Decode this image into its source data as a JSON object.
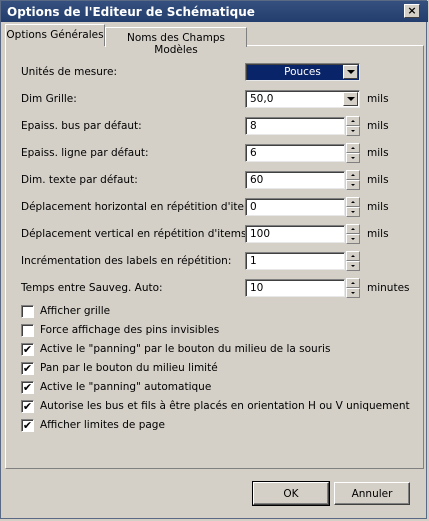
{
  "window": {
    "title": "Options de l'Editeur de Schématique",
    "close_glyph": "×"
  },
  "tabs": [
    {
      "label": "Options Générales",
      "active": true
    },
    {
      "label": "Noms des Champs Modèles",
      "active": false
    }
  ],
  "settings": {
    "units": {
      "label": "Unités de mesure:",
      "value": "Pouces"
    },
    "grid": {
      "label": "Dim Grille:",
      "value": "50,0",
      "unit": "mils"
    },
    "bus_width": {
      "label": "Epaiss. bus par défaut:",
      "value": "8",
      "unit": "mils"
    },
    "line_width": {
      "label": "Epaiss. ligne par défaut:",
      "value": "6",
      "unit": "mils"
    },
    "text_size": {
      "label": "Dim. texte par défaut:",
      "value": "60",
      "unit": "mils"
    },
    "repeat_h": {
      "label": "Déplacement horizontal en répétition d'items:",
      "value": "0",
      "unit": "mils"
    },
    "repeat_v": {
      "label": "Déplacement vertical en répétition d'items:",
      "value": "100",
      "unit": "mils"
    },
    "label_inc": {
      "label": "Incrémentation des labels en répétition:",
      "value": "1"
    },
    "autosave": {
      "label": "Temps entre Sauveg. Auto:",
      "value": "10",
      "unit": "minutes"
    }
  },
  "checkboxes": [
    {
      "label": "Afficher grille",
      "checked": false
    },
    {
      "label": "Force affichage des pins invisibles",
      "checked": false
    },
    {
      "label": "Active le \"panning\" par le bouton du milieu de la souris",
      "checked": true
    },
    {
      "label": "Pan par le bouton du milieu limité",
      "checked": true
    },
    {
      "label": "Active le \"panning\" automatique",
      "checked": true
    },
    {
      "label": "Autorise les bus et fils à être placés en orientation H ou V uniquement",
      "checked": true
    },
    {
      "label": " Afficher limites de page",
      "checked": true
    }
  ],
  "checkmark": "✔",
  "buttons": {
    "ok": "OK",
    "cancel": "Annuler"
  }
}
